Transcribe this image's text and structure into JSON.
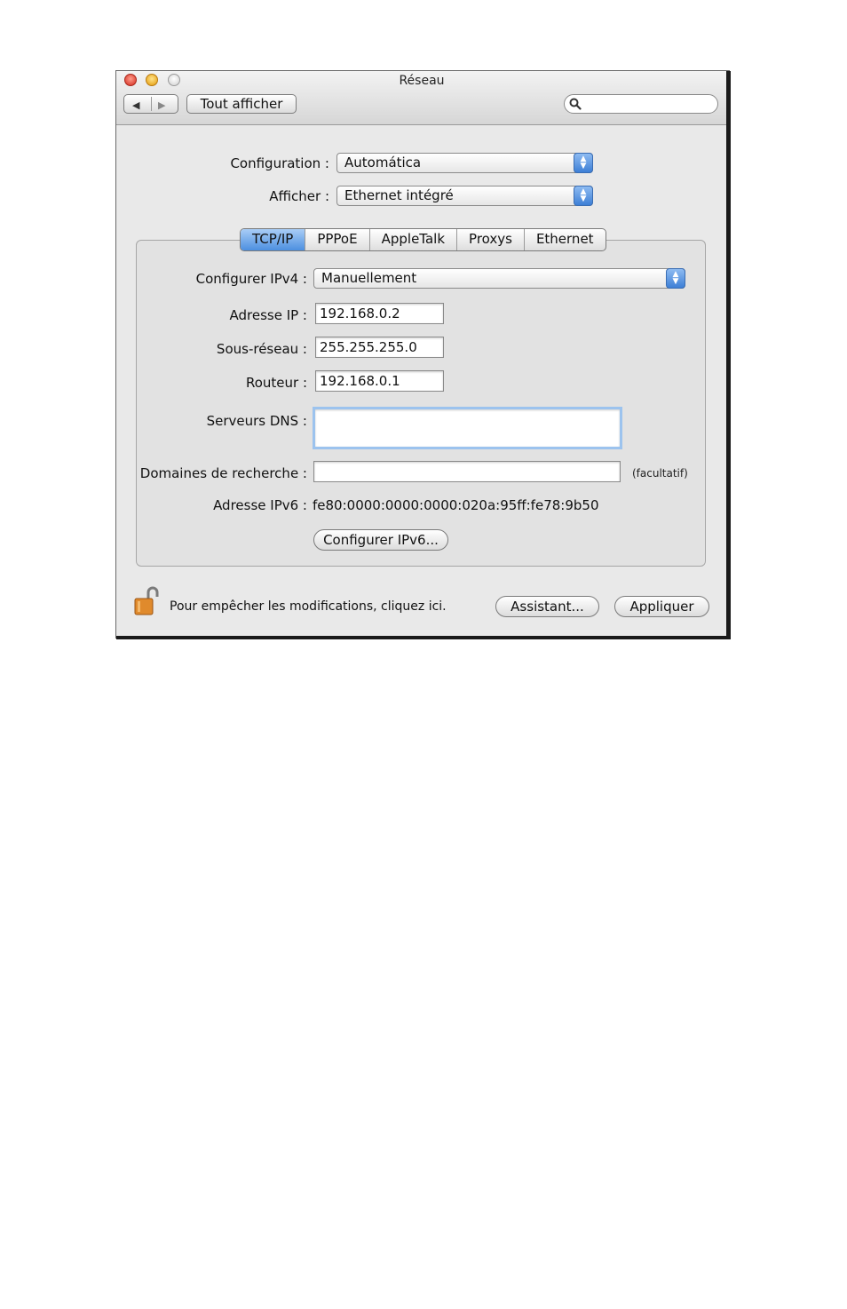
{
  "window": {
    "title": "Réseau"
  },
  "toolbar": {
    "show_all_label": "Tout afficher",
    "search_placeholder": "",
    "back_icon": "back-arrow-icon",
    "forward_icon": "forward-arrow-icon"
  },
  "top_form": {
    "configuration_label": "Configuration :",
    "configuration_value": "Automática",
    "show_label": "Afficher :",
    "show_value": "Ethernet intégré"
  },
  "tabs": [
    {
      "label": "TCP/IP",
      "active": true
    },
    {
      "label": "PPPoE",
      "active": false
    },
    {
      "label": "AppleTalk",
      "active": false
    },
    {
      "label": "Proxys",
      "active": false
    },
    {
      "label": "Ethernet",
      "active": false
    }
  ],
  "tcpip": {
    "configure_ipv4_label": "Configurer IPv4 :",
    "configure_ipv4_value": "Manuellement",
    "ip_label": "Adresse IP :",
    "ip_value": "192.168.0.2",
    "subnet_label": "Sous-réseau :",
    "subnet_value": "255.255.255.0",
    "router_label": "Routeur :",
    "router_value": "192.168.0.1",
    "dns_label": "Serveurs DNS :",
    "dns_value": "",
    "search_domains_label": "Domaines de recherche :",
    "search_domains_value": "",
    "optional_note": "(facultatif)",
    "ipv6_label": "Adresse IPv6 :",
    "ipv6_value": "fe80:0000:0000:0000:020a:95ff:fe78:9b50",
    "configure_ipv6_button": "Configurer IPv6...",
    "help_label": "?"
  },
  "footer": {
    "lock_text": "Pour empêcher les modifications, cliquez ici.",
    "assistant_button": "Assistant...",
    "apply_button": "Appliquer"
  },
  "colors": {
    "window_bg": "#e9e9e9",
    "accent_blue": "#4c8fe0",
    "close": "#d3291d",
    "minimize": "#e39a08"
  }
}
